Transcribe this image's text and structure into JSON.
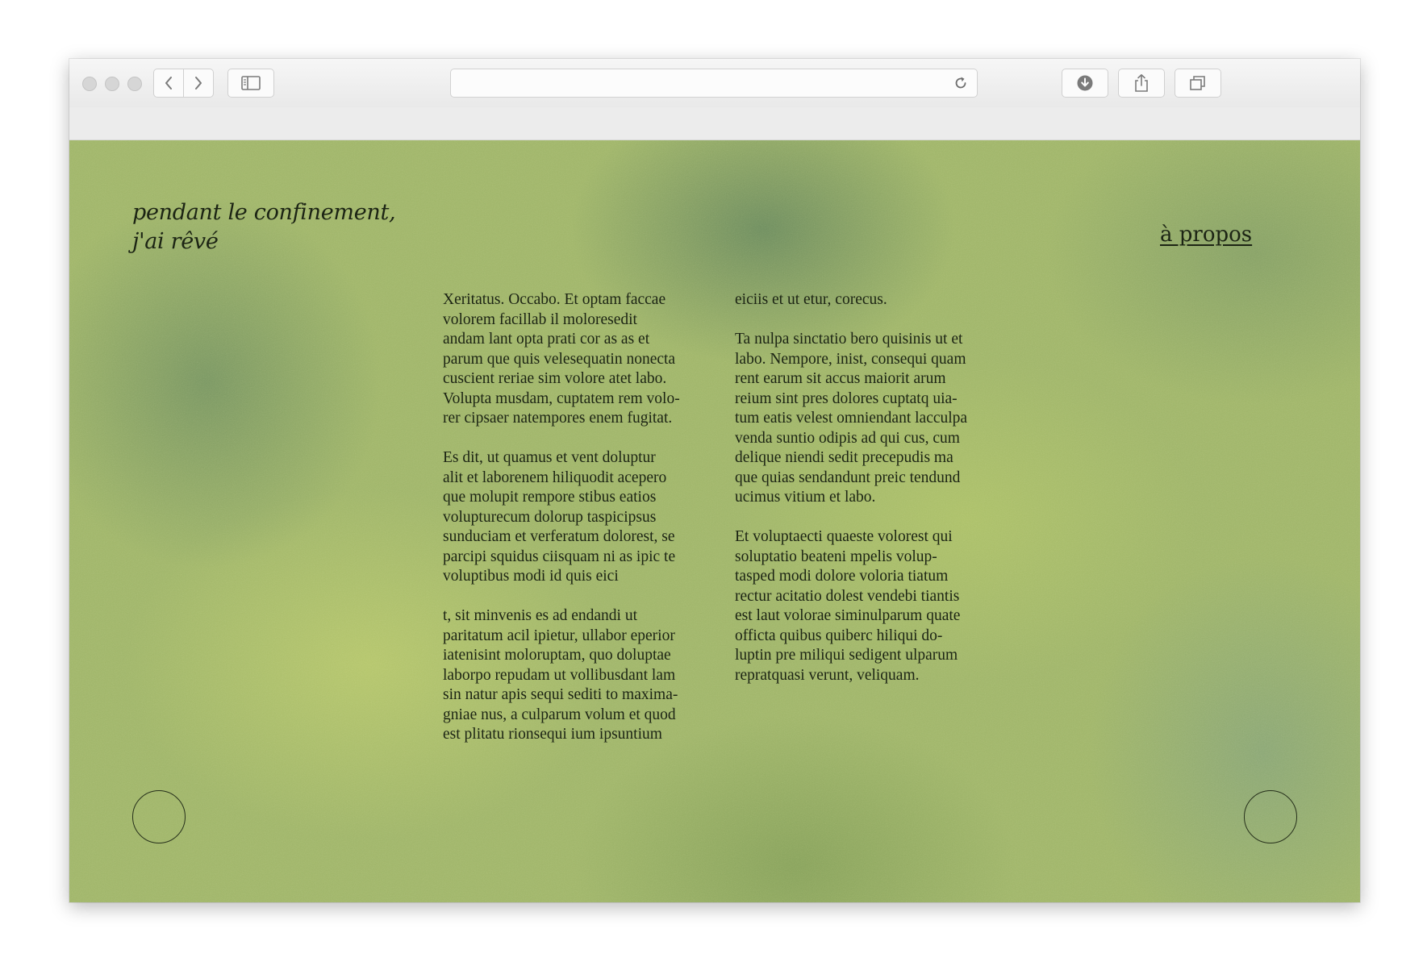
{
  "browser": {
    "toolbar": {
      "buttons": {
        "back": "chevron-left-icon",
        "forward": "chevron-right-icon",
        "sidebar": "sidebar-icon",
        "reload": "reload-icon",
        "download": "download-icon",
        "share": "share-icon",
        "tabs": "tabs-icon"
      },
      "address_value": ""
    }
  },
  "site": {
    "title_line1": "pendant le confinement,",
    "title_line2": "j'ai rêvé",
    "about_label": "à propos",
    "background_color": "#9fb569",
    "text_color": "#1c2414"
  },
  "article": {
    "left_column": [
      "Xeritatus. Occabo. Et optam faccae\nvolorem facillab il moloresedit\nandam lant opta prati cor as as et\nparum que quis velesequatin nonecta\ncuscient reriae sim volore atet labo.\nVolupta musdam, cuptatem rem volo-\nrer cipsaer natempores enem fugitat.",
      "Es dit, ut quamus et vent doluptur\nalit et laborenem hiliquodit acepero\nque molupit rempore stibus eatios\nvolupturecum dolorup taspicipsus\nsunduciam et verferatum dolorest, se\nparcipi squidus ciisquam ni as ipic te\nvoluptibus modi id quis eici",
      "t, sit minvenis es ad endandi ut\nparitatum acil ipietur, ullabor eperior\niatenisint moloruptam, quo doluptae\nlaborpo repudam ut vollibusdant lam\nsin natur apis sequi sediti to maxima-\ngniae nus, a culparum volum et quod\nest plitatu rionsequi ium ipsuntium"
    ],
    "right_column": [
      "eiciis et ut etur, corecus.",
      "Ta nulpa sinctatio bero quisinis ut et\nlabo. Nempore, inist, consequi quam\nrent earum sit accus maiorit arum\nreium sint pres dolores cuptatq uia-\ntum eatis velest omniendant lacculpa\nvenda suntio odipis ad qui cus, cum\ndelique niendi sedit precepudis ma\nque quias sendandunt preic tendund\nucimus vitium et labo.",
      " Et voluptaecti quaeste volorest qui\nsoluptatio beateni mpelis volup-\ntasped modi dolore voloria tiatum\nrectur acitatio dolest vendebi tiantis\nest laut volorae siminulparum quate\nofficta quibus quiberc hiliqui do-\nluptin pre miliqui sedigent ulparum\nrepratquasi verunt, veliquam."
    ]
  },
  "navigation": {
    "prev_icon": "circle-prev-icon",
    "next_icon": "circle-next-icon"
  }
}
